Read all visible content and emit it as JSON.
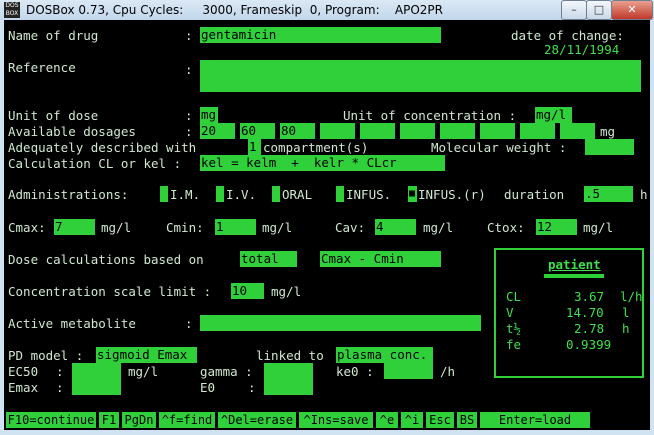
{
  "window": {
    "title": "DOSBox 0.73, Cpu Cycles:     3000, Frameskip  0, Program:    APO2PR",
    "icon_text": "DOS BOX",
    "buttons": {
      "minimize": "–",
      "maximize": "□",
      "close": "✕"
    }
  },
  "form": {
    "name_label": "Name of drug",
    "name_value": "gentamicin",
    "date_label": "date of change:",
    "date_value": "28/11/1994",
    "reference_label": "Reference",
    "unit_dose_label": "Unit of dose",
    "unit_dose_value": "mg",
    "unit_conc_label": "Unit of concentration :",
    "unit_conc_value": "mg/l",
    "available_label": "Available dosages",
    "dosages": [
      "20",
      "60",
      "80",
      "",
      "",
      "",
      "",
      "",
      "",
      ""
    ],
    "dosage_unit": "mg",
    "adequately_label": "Adequately described with",
    "compartments_value": "1",
    "compartments_label": "compartment(s)",
    "mw_label": "Molecular weight :",
    "calc_label": "Calculation CL or kel :",
    "calc_value": "kel = kelm  +  kelr * CLcr",
    "admin_label": "Administrations:",
    "admin_options": [
      "I.M.",
      "I.V.",
      "ORAL",
      "INFUS.",
      "INFUS.(r)"
    ],
    "admin_selected": "INFUS.(r)",
    "duration_label": "duration",
    "duration_value": ".5",
    "duration_unit": "h",
    "cmax_label": "Cmax:",
    "cmax_value": "7",
    "cmin_label": "Cmin:",
    "cmin_value": "1",
    "cav_label": "Cav:",
    "cav_value": "4",
    "ctox_label": "Ctox:",
    "ctox_value": "12",
    "conc_unit": "mg/l",
    "dose_calc_label": "Dose calculations based on",
    "dose_calc_basis": "total",
    "dose_calc_target": "Cmax - Cmin",
    "scale_label": "Concentration scale limit :",
    "scale_value": "10",
    "scale_unit": "mg/l",
    "metabolite_label": "Active metabolite",
    "pd_label": "PD model :",
    "pd_value": "sigmoid Emax",
    "linked_label": "linked to",
    "linked_value": "plasma conc.",
    "ec50_label": "EC50",
    "ec50_unit": "mg/l",
    "gamma_label": "gamma :",
    "ke0_label": "ke0 :",
    "ke0_unit": "/h",
    "emax_label": "Emax",
    "e0_label": "E0"
  },
  "patient": {
    "title": "patient",
    "rows": [
      {
        "label": "CL",
        "value": "3.67",
        "unit": "l/h"
      },
      {
        "label": "V",
        "value": "14.70",
        "unit": "l"
      },
      {
        "label": "t½",
        "value": "2.78",
        "unit": "h"
      },
      {
        "label": "fe",
        "value": "0.9399",
        "unit": ""
      }
    ]
  },
  "bottom_keys": [
    "F10=continue",
    "F1",
    "PgDn",
    "^f=find",
    "^Del=erase",
    "^Ins=save",
    "^e",
    "^i",
    "Esc",
    "BS",
    "Enter=load"
  ],
  "colors": {
    "field_green": "#2fd03a",
    "screen_black": "#000000",
    "text": "#cfe8cf"
  }
}
